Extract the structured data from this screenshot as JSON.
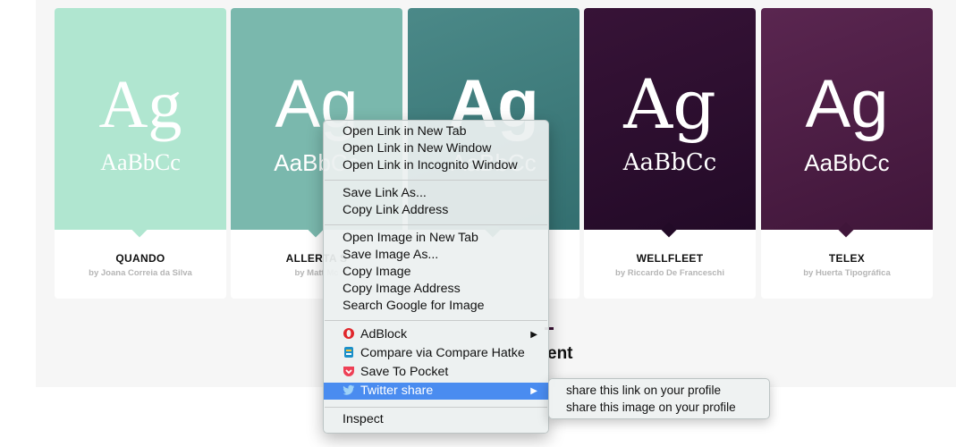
{
  "cards": [
    {
      "ag": "Ag",
      "sample": "AaBbCc",
      "name": "QUANDO",
      "by": "by Joana Correia da Silva",
      "color": "#b0e6d0",
      "text_color": "#ffffff"
    },
    {
      "ag": "Ag",
      "sample": "AaBbCc",
      "name": "ALLERTA S",
      "by": "by Matt Mc",
      "color": "#7ab8ad",
      "text_color": "#ffffff"
    },
    {
      "ag": "Ag",
      "sample": "AaBbCc",
      "name": "",
      "by": "",
      "color": "#3b7a79",
      "text_color": "#ffffff"
    },
    {
      "ag": "Ag",
      "sample": "AaBbCc",
      "name": "WELLFLEET",
      "by": "by Riccardo De Franceschi",
      "color": "#2a0c2d",
      "text_color": "#ffffff"
    },
    {
      "ag": "Ag",
      "sample": "AaBbCc",
      "name": "TELEX",
      "by": "by Huerta Tipográfica",
      "color": "#4a1a3e",
      "text_color": "#ffffff"
    }
  ],
  "background_heading_partial": "ent",
  "context_menu": {
    "open_new_tab": "Open Link in New Tab",
    "open_new_window": "Open Link in New Window",
    "open_incognito": "Open Link in Incognito Window",
    "save_link_as": "Save Link As...",
    "copy_link_address": "Copy Link Address",
    "open_image_new_tab": "Open Image in New Tab",
    "save_image_as": "Save Image As...",
    "copy_image": "Copy Image",
    "copy_image_address": "Copy Image Address",
    "search_google_image": "Search Google for Image",
    "adblock": "AdBlock",
    "compare_hatke": "Compare via Compare Hatke",
    "save_to_pocket": "Save To Pocket",
    "twitter_share": "Twitter share",
    "inspect": "Inspect",
    "submenu_arrow": "▶",
    "icons": {
      "adblock": "opera-icon",
      "compare": "compare-hatke-icon",
      "pocket": "pocket-icon",
      "twitter": "twitter-bird-icon"
    },
    "highlight_color": "#4a8cf0"
  },
  "twitter_submenu": {
    "share_link": "share this link on your profile",
    "share_image": "share this image on your profile"
  }
}
